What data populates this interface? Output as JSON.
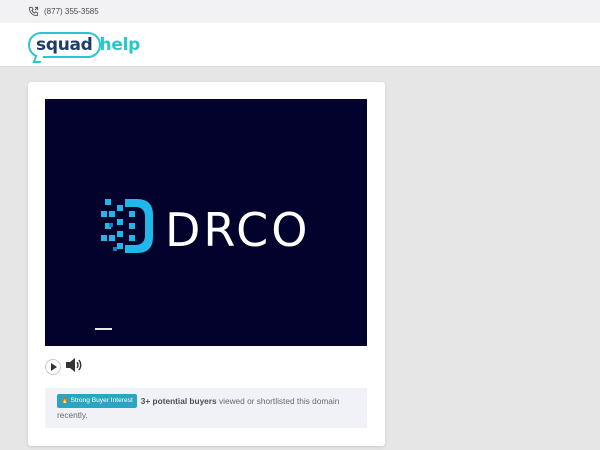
{
  "topbar": {
    "phone": "(877) 355-3585",
    "phone_icon": "phone-icon"
  },
  "header": {
    "logo_part1": "squad",
    "logo_part2": "help",
    "logo_colors": {
      "dark": "#1f3c6e",
      "accent": "#28c7cf"
    }
  },
  "video": {
    "background": "#03022c",
    "brand_text": "DRCO",
    "brand_color": "#1fb8e8"
  },
  "controls": {
    "play_icon": "play-icon",
    "volume_icon": "volume-icon"
  },
  "interest": {
    "badge_label": "Strong Buyer Interest",
    "highlight": "3+ potential buyers",
    "text": " viewed or shortlisted this domain recently."
  }
}
